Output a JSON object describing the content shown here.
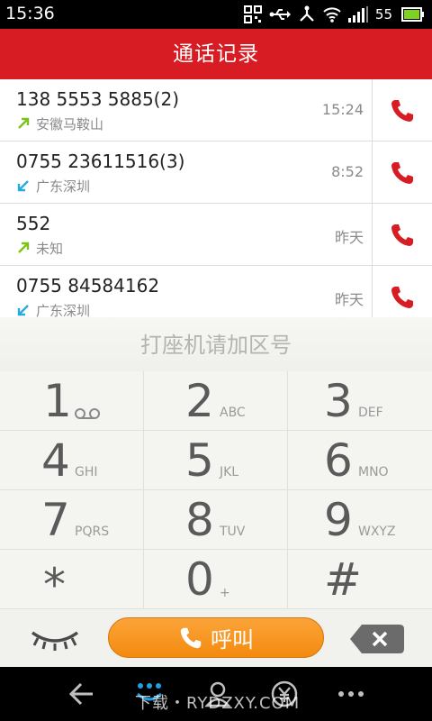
{
  "status_bar": {
    "time": "15:36",
    "battery_level": "55",
    "icons": [
      "qr-icon",
      "usb-icon",
      "share-icon",
      "wifi-icon",
      "signal-icon",
      "battery-icon"
    ]
  },
  "title": "通话记录",
  "colors": {
    "title_bar": "#d81c23",
    "call_icon": "#d81c23",
    "call_button": "#f7941d",
    "outgoing_arrow": "#7cc219",
    "incoming_arrow": "#2aa9e0"
  },
  "calls": [
    {
      "number": "138 5553 5885(2)",
      "location": "安徽马鞍山",
      "time": "15:24",
      "direction": "outgoing"
    },
    {
      "number": "0755 23611516(3)",
      "location": "广东深圳",
      "time": "8:52",
      "direction": "incoming"
    },
    {
      "number": "552",
      "location": "未知",
      "time": "昨天",
      "direction": "outgoing"
    },
    {
      "number": "0755 84584162",
      "location": "广东深圳",
      "time": "昨天",
      "direction": "incoming"
    }
  ],
  "dialpad": {
    "hint": "打座机请加区号",
    "keys": [
      {
        "digit": "1",
        "letters": ""
      },
      {
        "digit": "2",
        "letters": "ABC"
      },
      {
        "digit": "3",
        "letters": "DEF"
      },
      {
        "digit": "4",
        "letters": "GHI"
      },
      {
        "digit": "5",
        "letters": "JKL"
      },
      {
        "digit": "6",
        "letters": "MNO"
      },
      {
        "digit": "7",
        "letters": "PQRS"
      },
      {
        "digit": "8",
        "letters": "TUV"
      },
      {
        "digit": "9",
        "letters": "WXYZ"
      },
      {
        "digit": "*",
        "letters": ""
      },
      {
        "digit": "0",
        "letters": "+"
      },
      {
        "digit": "#",
        "letters": ""
      }
    ],
    "call_label": "呼叫"
  },
  "watermark": "下载・RYDZXY.COM"
}
